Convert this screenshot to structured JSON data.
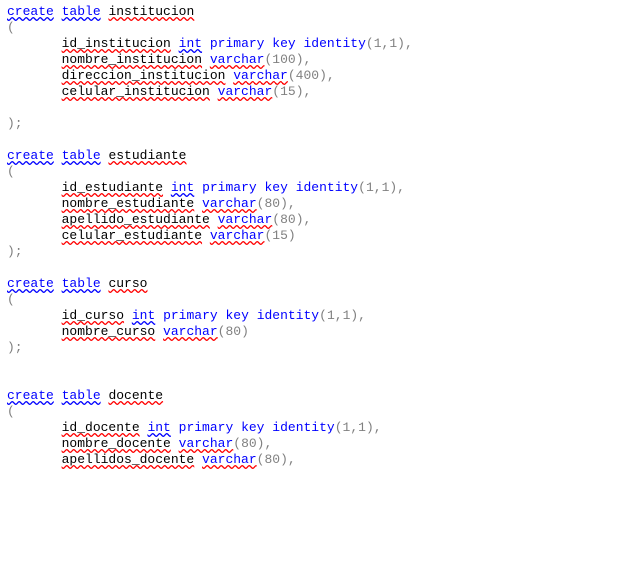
{
  "lines": [
    [
      {
        "t": "create",
        "cls": "kw sq-blue"
      },
      {
        "t": " "
      },
      {
        "t": "table",
        "cls": "kw sq-blue"
      },
      {
        "t": " "
      },
      {
        "t": "institucion",
        "cls": "sq-red"
      }
    ],
    [
      {
        "t": "(",
        "cls": "pn"
      }
    ],
    [
      {
        "t": "       "
      },
      {
        "t": "id_institucion",
        "cls": "sq-red"
      },
      {
        "t": " "
      },
      {
        "t": "int",
        "cls": "kw sq-blue"
      },
      {
        "t": " "
      },
      {
        "t": "primary",
        "cls": "kw"
      },
      {
        "t": " "
      },
      {
        "t": "key",
        "cls": "kw"
      },
      {
        "t": " "
      },
      {
        "t": "identity",
        "cls": "kw"
      },
      {
        "t": "(",
        "cls": "pn"
      },
      {
        "t": "1",
        "cls": "num"
      },
      {
        "t": ",",
        "cls": "pn"
      },
      {
        "t": "1",
        "cls": "num"
      },
      {
        "t": "),",
        "cls": "pn"
      }
    ],
    [
      {
        "t": "       "
      },
      {
        "t": "nombre_institucion",
        "cls": "sq-red"
      },
      {
        "t": " "
      },
      {
        "t": "varchar",
        "cls": "kw sq-red"
      },
      {
        "t": "(",
        "cls": "pn"
      },
      {
        "t": "100",
        "cls": "num"
      },
      {
        "t": "),",
        "cls": "pn"
      }
    ],
    [
      {
        "t": "       "
      },
      {
        "t": "direccion_institucion",
        "cls": "sq-red"
      },
      {
        "t": " "
      },
      {
        "t": "varchar",
        "cls": "kw sq-red"
      },
      {
        "t": "(",
        "cls": "pn"
      },
      {
        "t": "400",
        "cls": "num"
      },
      {
        "t": "),",
        "cls": "pn"
      }
    ],
    [
      {
        "t": "       "
      },
      {
        "t": "celular_institucion",
        "cls": "sq-red"
      },
      {
        "t": " "
      },
      {
        "t": "varchar",
        "cls": "kw sq-red"
      },
      {
        "t": "(",
        "cls": "pn"
      },
      {
        "t": "15",
        "cls": "num"
      },
      {
        "t": "),",
        "cls": "pn"
      }
    ],
    [],
    [
      {
        "t": ");",
        "cls": "pn"
      }
    ],
    [],
    [
      {
        "t": "create",
        "cls": "kw sq-blue"
      },
      {
        "t": " "
      },
      {
        "t": "table",
        "cls": "kw sq-blue"
      },
      {
        "t": " "
      },
      {
        "t": "estudiante",
        "cls": "sq-red"
      }
    ],
    [
      {
        "t": "(",
        "cls": "pn"
      }
    ],
    [
      {
        "t": "       "
      },
      {
        "t": "id_estudiante",
        "cls": "sq-red"
      },
      {
        "t": " "
      },
      {
        "t": "int",
        "cls": "kw sq-blue"
      },
      {
        "t": " "
      },
      {
        "t": "primary",
        "cls": "kw"
      },
      {
        "t": " "
      },
      {
        "t": "key",
        "cls": "kw"
      },
      {
        "t": " "
      },
      {
        "t": "identity",
        "cls": "kw"
      },
      {
        "t": "(",
        "cls": "pn"
      },
      {
        "t": "1",
        "cls": "num"
      },
      {
        "t": ",",
        "cls": "pn"
      },
      {
        "t": "1",
        "cls": "num"
      },
      {
        "t": "),",
        "cls": "pn"
      }
    ],
    [
      {
        "t": "       "
      },
      {
        "t": "nombre_estudiante",
        "cls": "sq-red"
      },
      {
        "t": " "
      },
      {
        "t": "varchar",
        "cls": "kw sq-red"
      },
      {
        "t": "(",
        "cls": "pn"
      },
      {
        "t": "80",
        "cls": "num"
      },
      {
        "t": "),",
        "cls": "pn"
      }
    ],
    [
      {
        "t": "       "
      },
      {
        "t": "apellido_estudiante",
        "cls": "sq-red"
      },
      {
        "t": " "
      },
      {
        "t": "varchar",
        "cls": "kw sq-red"
      },
      {
        "t": "(",
        "cls": "pn"
      },
      {
        "t": "80",
        "cls": "num"
      },
      {
        "t": "),",
        "cls": "pn"
      }
    ],
    [
      {
        "t": "       "
      },
      {
        "t": "celular_estudiante",
        "cls": "sq-red"
      },
      {
        "t": " "
      },
      {
        "t": "varchar",
        "cls": "kw sq-red"
      },
      {
        "t": "(",
        "cls": "pn"
      },
      {
        "t": "15",
        "cls": "num"
      },
      {
        "t": ")",
        "cls": "pn"
      }
    ],
    [
      {
        "t": ");",
        "cls": "pn"
      }
    ],
    [],
    [
      {
        "t": "create",
        "cls": "kw sq-blue"
      },
      {
        "t": " "
      },
      {
        "t": "table",
        "cls": "kw sq-blue"
      },
      {
        "t": " "
      },
      {
        "t": "curso",
        "cls": "sq-red"
      }
    ],
    [
      {
        "t": "(",
        "cls": "pn"
      }
    ],
    [
      {
        "t": "       "
      },
      {
        "t": "id_curso",
        "cls": "sq-red"
      },
      {
        "t": " "
      },
      {
        "t": "int",
        "cls": "kw sq-blue"
      },
      {
        "t": " "
      },
      {
        "t": "primary",
        "cls": "kw"
      },
      {
        "t": " "
      },
      {
        "t": "key",
        "cls": "kw"
      },
      {
        "t": " "
      },
      {
        "t": "identity",
        "cls": "kw"
      },
      {
        "t": "(",
        "cls": "pn"
      },
      {
        "t": "1",
        "cls": "num"
      },
      {
        "t": ",",
        "cls": "pn"
      },
      {
        "t": "1",
        "cls": "num"
      },
      {
        "t": "),",
        "cls": "pn"
      }
    ],
    [
      {
        "t": "       "
      },
      {
        "t": "nombre_curso",
        "cls": "sq-red"
      },
      {
        "t": " "
      },
      {
        "t": "varchar",
        "cls": "kw sq-red"
      },
      {
        "t": "(",
        "cls": "pn"
      },
      {
        "t": "80",
        "cls": "num"
      },
      {
        "t": ")",
        "cls": "pn"
      }
    ],
    [
      {
        "t": ");",
        "cls": "pn"
      }
    ],
    [],
    [],
    [
      {
        "t": "create",
        "cls": "kw sq-blue"
      },
      {
        "t": " "
      },
      {
        "t": "table",
        "cls": "kw sq-blue"
      },
      {
        "t": " "
      },
      {
        "t": "docente",
        "cls": "sq-red"
      }
    ],
    [
      {
        "t": "(",
        "cls": "pn"
      }
    ],
    [
      {
        "t": "       "
      },
      {
        "t": "id_docente",
        "cls": "sq-red"
      },
      {
        "t": " "
      },
      {
        "t": "int",
        "cls": "kw sq-blue"
      },
      {
        "t": " "
      },
      {
        "t": "primary",
        "cls": "kw"
      },
      {
        "t": " "
      },
      {
        "t": "key",
        "cls": "kw"
      },
      {
        "t": " "
      },
      {
        "t": "identity",
        "cls": "kw"
      },
      {
        "t": "(",
        "cls": "pn"
      },
      {
        "t": "1",
        "cls": "num"
      },
      {
        "t": ",",
        "cls": "pn"
      },
      {
        "t": "1",
        "cls": "num"
      },
      {
        "t": "),",
        "cls": "pn"
      }
    ],
    [
      {
        "t": "       "
      },
      {
        "t": "nombre_docente",
        "cls": "sq-red"
      },
      {
        "t": " "
      },
      {
        "t": "varchar",
        "cls": "kw sq-red"
      },
      {
        "t": "(",
        "cls": "pn"
      },
      {
        "t": "80",
        "cls": "num"
      },
      {
        "t": "),",
        "cls": "pn"
      }
    ],
    [
      {
        "t": "       "
      },
      {
        "t": "apellidos_docente",
        "cls": "sq-red"
      },
      {
        "t": " "
      },
      {
        "t": "varchar",
        "cls": "kw sq-red"
      },
      {
        "t": "(",
        "cls": "pn"
      },
      {
        "t": "80",
        "cls": "num"
      },
      {
        "t": "),",
        "cls": "pn"
      }
    ]
  ]
}
